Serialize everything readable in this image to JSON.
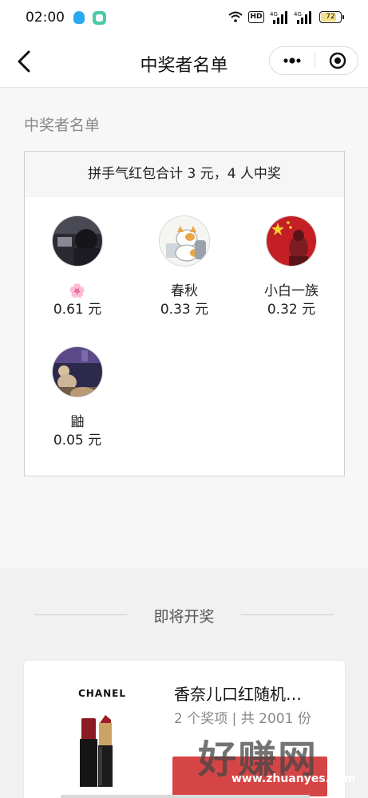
{
  "status_bar": {
    "time": "02:00",
    "network_badge": "HD",
    "signal_1": "4G",
    "signal_2": "4G",
    "battery": "72",
    "battery_level": 0.72,
    "icons": [
      "qq-icon",
      "chat-icon",
      "wifi-icon",
      "hd-icon",
      "signal-icon",
      "signal-icon",
      "battery-icon"
    ]
  },
  "nav": {
    "title": "中奖者名单",
    "icons": [
      "back-arrow-icon",
      "more-dots-icon",
      "close-target-icon"
    ]
  },
  "section": {
    "title": "中奖者名单"
  },
  "summary": "拼手气红包合计 3 元，4 人中奖",
  "winners": [
    {
      "name": "🌸",
      "amount": "0.61 元",
      "avatar": "avatar-dark-photo"
    },
    {
      "name": "春秋",
      "amount": "0.33 元",
      "avatar": "avatar-cat-cartoon"
    },
    {
      "name": "小白一族",
      "amount": "0.32 元",
      "avatar": "avatar-flag-photo"
    },
    {
      "name": "鼬",
      "amount": "0.05 元",
      "avatar": "avatar-night-photo"
    }
  ],
  "upcoming": {
    "heading": "即将开奖",
    "prize": {
      "brand": "CHANEL",
      "title": "香奈儿口红随机…",
      "meta": "2 个奖项 | 共 2001 份"
    }
  },
  "watermark": {
    "text": "好赚网",
    "url": "www.zhuanyes.com"
  },
  "colors": {
    "accent_red": "#d64545",
    "page_bg": "#f7f7f7",
    "card_header_bg": "#f6f6f6"
  }
}
